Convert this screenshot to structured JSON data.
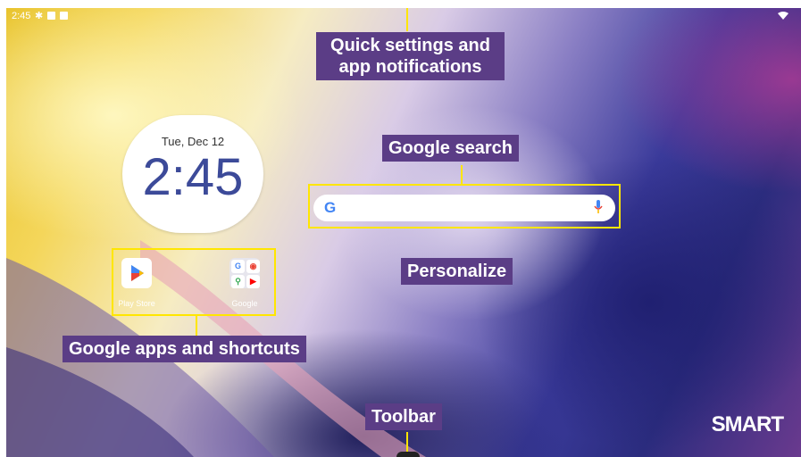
{
  "status_bar": {
    "time": "2:45"
  },
  "clock_widget": {
    "date": "Tue, Dec 12",
    "time": "2:45"
  },
  "apps": [
    {
      "label": "Play Store",
      "icon": "play-store-icon"
    },
    {
      "label": "Google",
      "icon": "google-folder-icon"
    }
  ],
  "annotations": {
    "quick_settings_line1": "Quick settings and",
    "quick_settings_line2": "app notifications",
    "google_search": "Google search",
    "personalize": "Personalize",
    "google_apps": "Google apps and shortcuts",
    "toolbar": "Toolbar"
  },
  "brand": {
    "logo": "SMART"
  },
  "colors": {
    "annotation_bg": "#5b3d86",
    "highlight": "#ffe600",
    "clock_text": "#3c4a99"
  }
}
